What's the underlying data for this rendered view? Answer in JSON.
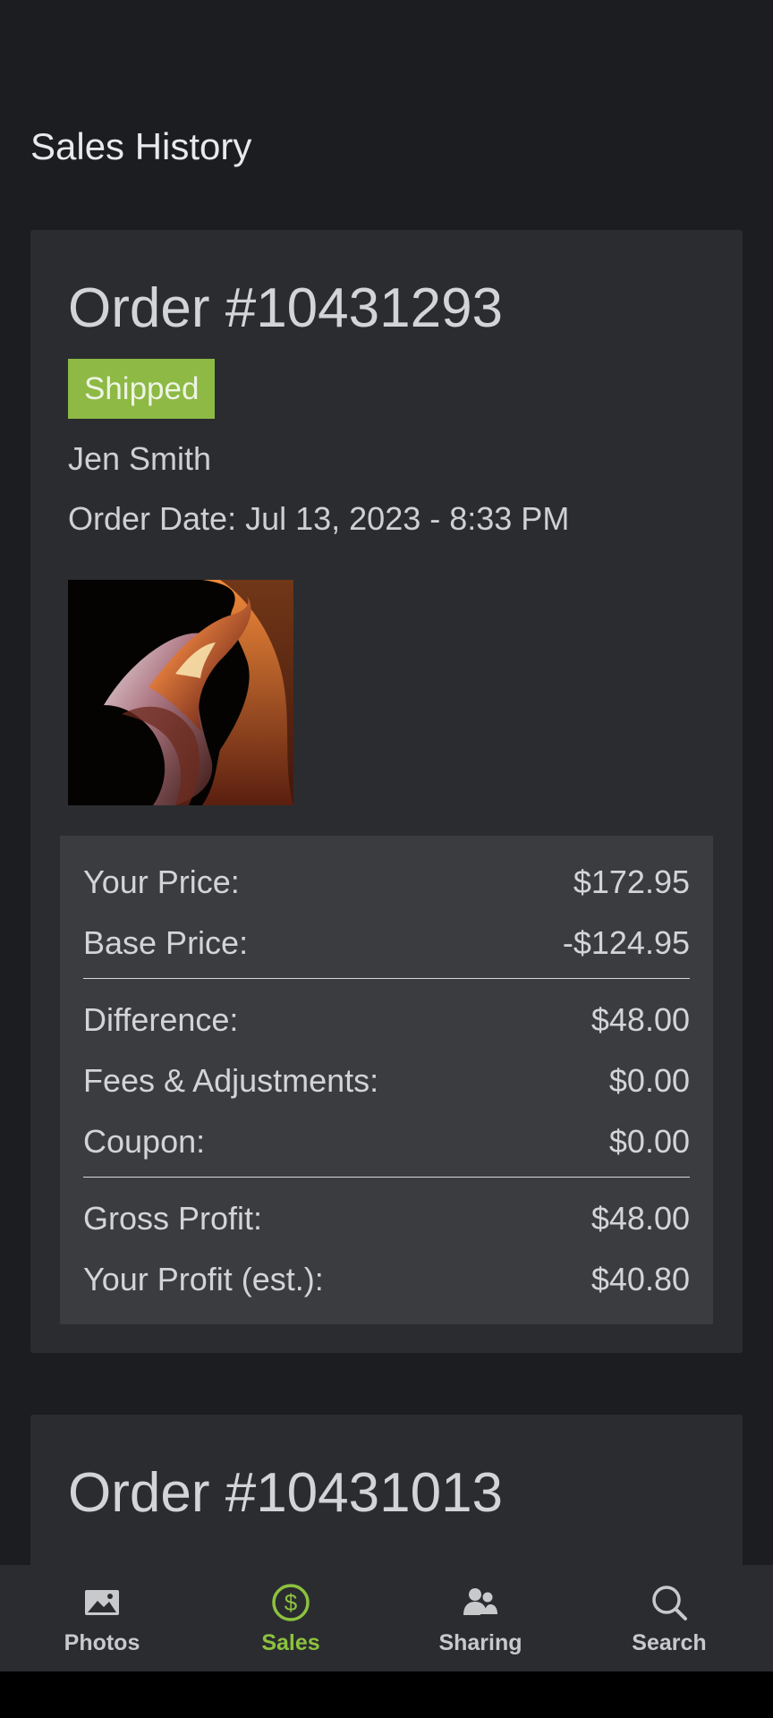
{
  "header": {
    "title": "Sales History"
  },
  "orders": [
    {
      "title": "Order #10431293",
      "status": "Shipped",
      "customer": "Jen Smith",
      "order_date_label": "Order Date:",
      "order_date": "Jul 13, 2023 - 8:33 PM",
      "pricing": {
        "your_price_label": "Your Price:",
        "your_price": "$172.95",
        "base_price_label": "Base Price:",
        "base_price": "-$124.95",
        "difference_label": "Difference:",
        "difference": "$48.00",
        "fees_label": "Fees & Adjustments:",
        "fees": "$0.00",
        "coupon_label": "Coupon:",
        "coupon": "$0.00",
        "gross_profit_label": "Gross Profit:",
        "gross_profit": "$48.00",
        "your_profit_label": "Your Profit (est.):",
        "your_profit": "$40.80"
      }
    },
    {
      "title": "Order #10431013"
    }
  ],
  "nav": {
    "items": [
      {
        "label": "Photos",
        "icon": "photo-icon"
      },
      {
        "label": "Sales",
        "icon": "dollar-icon"
      },
      {
        "label": "Sharing",
        "icon": "people-icon"
      },
      {
        "label": "Search",
        "icon": "search-icon"
      }
    ],
    "active_color": "#8cc23e",
    "status_color": "#8db944"
  }
}
